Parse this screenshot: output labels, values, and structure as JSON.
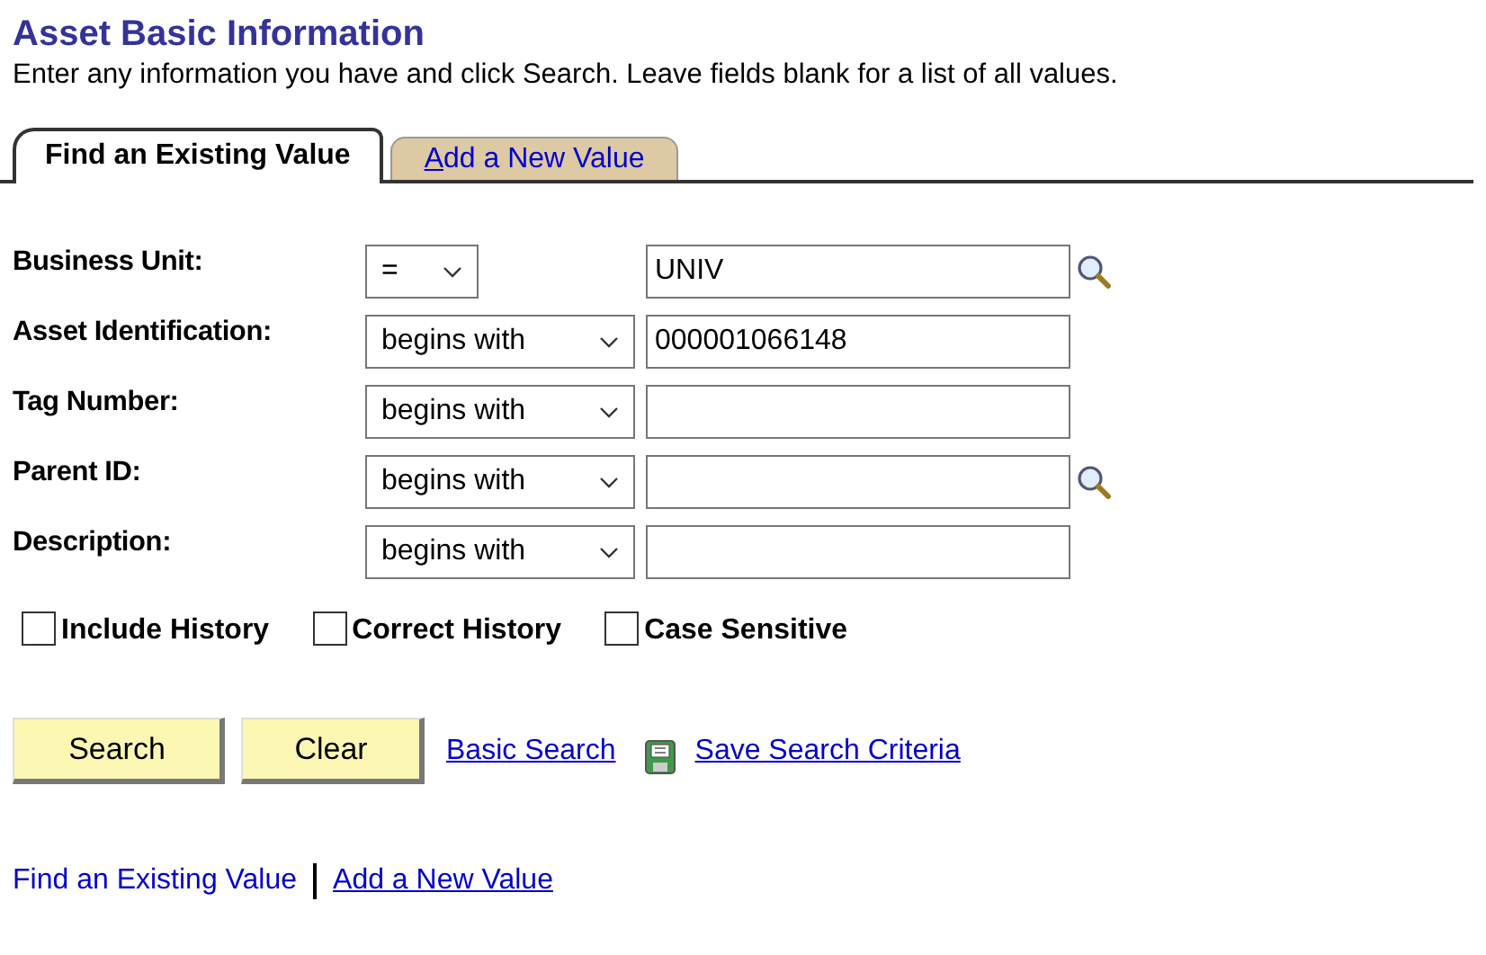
{
  "title": "Asset Basic Information",
  "instructions": "Enter any information you have and click Search. Leave fields blank for a list of all values.",
  "tabs": [
    {
      "label": "Find an Existing Value",
      "selected": true
    },
    {
      "label": "Add a New Value",
      "selected": false
    }
  ],
  "fields": [
    {
      "label": "Business Unit:",
      "operator": "=",
      "value": "UNIV",
      "lookup": true
    },
    {
      "label": "Asset Identification:",
      "operator": "begins with",
      "value": "000001066148",
      "lookup": false
    },
    {
      "label": "Tag Number:",
      "operator": "begins with",
      "lookup": false
    },
    {
      "label": "Parent ID:",
      "operator": "begins with",
      "lookup": true
    },
    {
      "label": "Description:",
      "operator": "begins with",
      "lookup": false
    }
  ],
  "checkboxes": [
    {
      "label": "Include History",
      "checked": false
    },
    {
      "label": "Correct History",
      "checked": false
    },
    {
      "label": "Case Sensitive",
      "checked": false
    }
  ],
  "buttons": [
    "Search",
    "Clear"
  ],
  "links": [
    "Basic Search",
    "Save Search Criteria"
  ],
  "footer_links": [
    "Find an Existing Value",
    "Add a New Value"
  ]
}
